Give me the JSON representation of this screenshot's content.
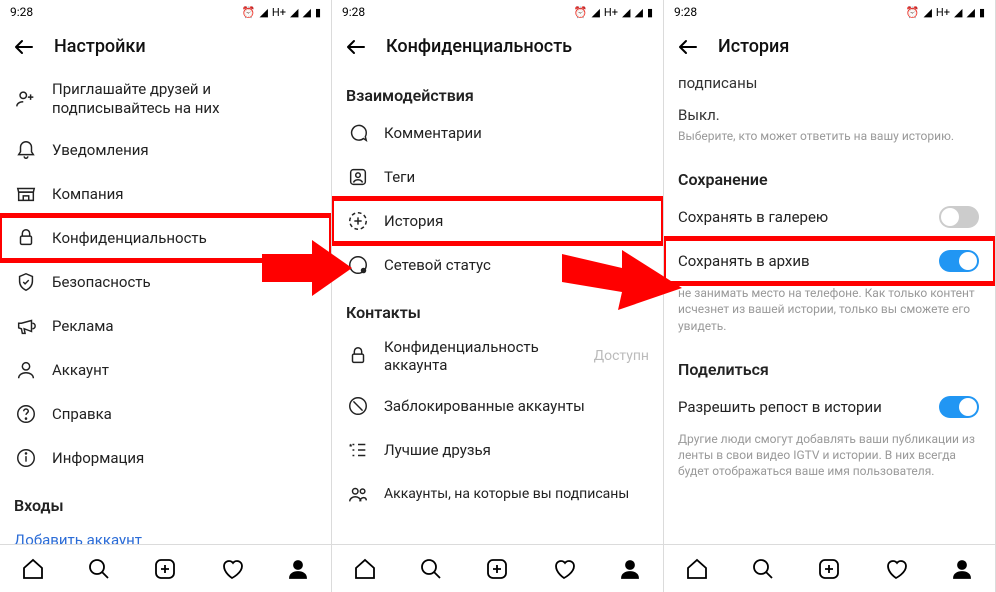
{
  "status": {
    "time": "9:28",
    "net": "H+"
  },
  "screen1": {
    "title": "Настройки",
    "items": {
      "invite": "Приглашайте друзей и подписывайтесь на них",
      "notifications": "Уведомления",
      "business": "Компания",
      "privacy": "Конфиденциальность",
      "security": "Безопасность",
      "ads": "Реклама",
      "account": "Аккаунт",
      "help": "Справка",
      "about": "Информация"
    },
    "logins_header": "Входы",
    "add_account": "Добавить аккаунт"
  },
  "screen2": {
    "title": "Конфиденциальность",
    "section1": "Взаимодействия",
    "items": {
      "comments": "Комментарии",
      "tags": "Теги",
      "story": "История",
      "activity": "Сетевой статус"
    },
    "section2": "Контакты",
    "items2": {
      "acct_privacy": "Конфиденциальность аккаунта",
      "acct_privacy_trail": "Доступн",
      "blocked": "Заблокированные аккаунты",
      "close_friends": "Лучшие друзья",
      "following": "Аккаунты, на которые вы подписаны"
    }
  },
  "screen3": {
    "title": "История",
    "subscribed": "подписаны",
    "off": "Выкл.",
    "choose_hint": "Выберите, кто может ответить на вашу историю.",
    "saving_header": "Сохранение",
    "save_gallery": "Сохранять в галерею",
    "save_archive": "Сохранять в архив",
    "archive_hint": "не занимать место на телефоне. Как только контент исчезнет из вашей истории, только вы сможете его увидеть.",
    "share_header": "Поделиться",
    "allow_reshare": "Разрешить репост в истории",
    "reshare_hint": "Другие люди смогут добавлять ваши публикации из ленты в свои видео IGTV и истории. В них всегда будет отображаться ваше имя пользователя."
  }
}
